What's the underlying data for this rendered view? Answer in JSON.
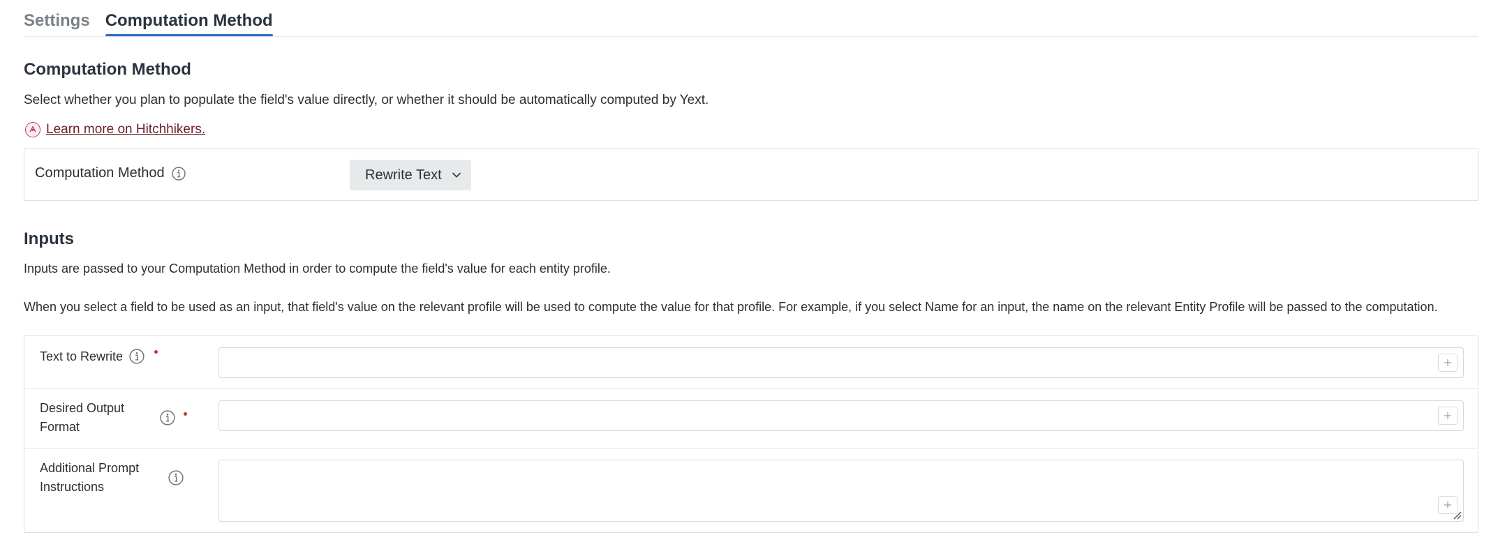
{
  "tabs": [
    {
      "label": "Settings",
      "active": false
    },
    {
      "label": "Computation Method",
      "active": true
    }
  ],
  "method_section": {
    "title": "Computation Method",
    "description": "Select whether you plan to populate the field's value directly, or whether it should be automatically computed by Yext.",
    "learn_more": "Learn more on Hitchhikers.",
    "field_label": "Computation Method",
    "selected_value": "Rewrite Text"
  },
  "inputs_section": {
    "title": "Inputs",
    "description_1": "Inputs are passed to your Computation Method in order to compute the field's value for each entity profile.",
    "description_2": "When you select a field to be used as an input, that field's value on the relevant profile will be used to compute the value for that profile. For example, if you select Name for an input, the name on the relevant Entity Profile will be passed to the computation.",
    "rows": [
      {
        "label": "Text to Rewrite",
        "required": true,
        "value": ""
      },
      {
        "label": "Desired Output Format",
        "required": true,
        "value": ""
      },
      {
        "label": "Additional Prompt Instructions",
        "required": false,
        "value": ""
      }
    ]
  },
  "colors": {
    "tab_underline": "#2d6ac4",
    "required": "#c0392b",
    "link": "#6b1f2a"
  },
  "icons": {
    "info": "info-icon",
    "add": "plus-icon",
    "dropdown": "chevron-down-icon",
    "hitchhikers": "hitchhikers-logo-icon"
  }
}
